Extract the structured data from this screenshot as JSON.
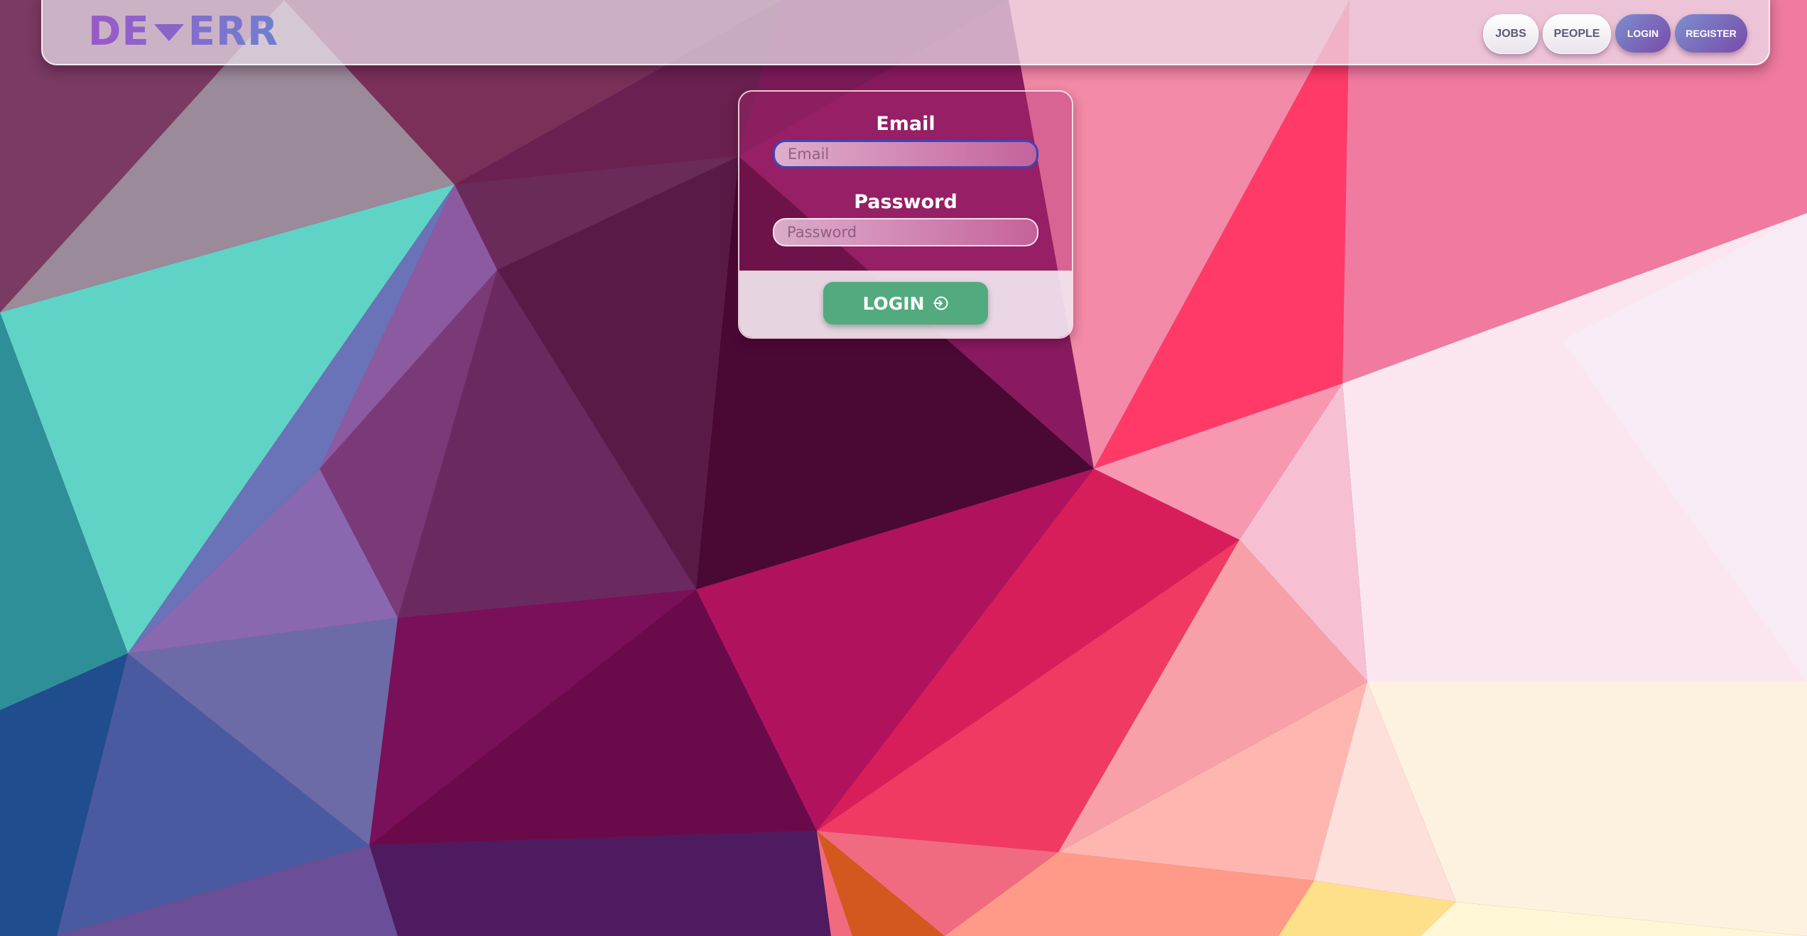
{
  "header": {
    "logo": {
      "left": "DE",
      "right": "ERR",
      "icon": "triangle-down-icon"
    },
    "nav": [
      {
        "label": "JOBS",
        "style": "light"
      },
      {
        "label": "PEOPLE",
        "style": "light"
      },
      {
        "label": "LOGIN",
        "style": "gradient"
      },
      {
        "label": "REGISTER",
        "style": "gradient"
      }
    ]
  },
  "login_form": {
    "email": {
      "label": "Email",
      "placeholder": "Email",
      "value": "",
      "focused": true
    },
    "password": {
      "label": "Password",
      "placeholder": "Password",
      "value": ""
    },
    "submit": {
      "label": "LOGIN",
      "icon": "login-arrow-icon"
    }
  },
  "colors": {
    "logo_gradient_start": "#9a58c8",
    "logo_gradient_end": "#6f7fd0",
    "login_button": "#52aa7e",
    "email_focus_border": "#3a45b8",
    "nav_gradient_start": "#7b8fd0",
    "nav_gradient_end": "#7a4aa8"
  },
  "background": {
    "style": "low-poly gradient",
    "palette": [
      "#56d6c8",
      "#7a2a5a",
      "#4a0035",
      "#a8155e",
      "#ff3b6b",
      "#f7e8f2",
      "#fff3d8",
      "#2a4a8a"
    ]
  }
}
